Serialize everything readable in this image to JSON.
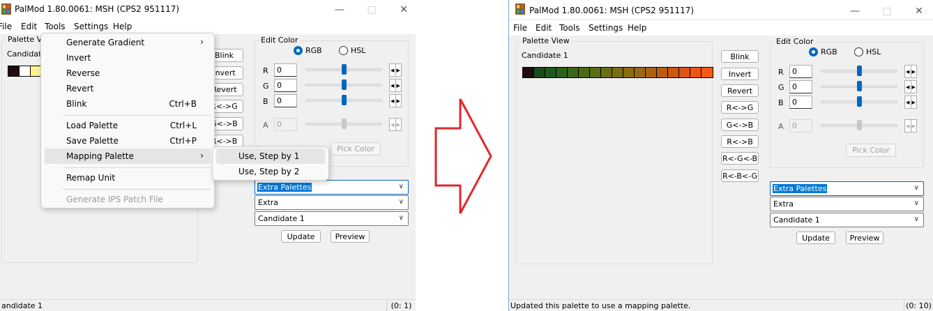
{
  "colors": {
    "accent": "#0067c0",
    "arrow_stroke": "#e3262d",
    "selection": "#0078d7"
  },
  "left_window": {
    "title": "PalMod 1.80.0061: MSH (CPS2 951117)",
    "menu": {
      "file": "File",
      "edit": "Edit",
      "tools": "Tools",
      "settings": "Settings",
      "help": "Help"
    },
    "palette_view": {
      "title": "Palette Vie",
      "candidate_label": "Candidate"
    },
    "side_buttons": {
      "blink": "Blink",
      "invert": "Invert",
      "revert": "Revert",
      "rg": "R<->G",
      "gb": "G<->B",
      "rb": "R<->B"
    },
    "edit_color": {
      "title": "Edit Color",
      "rgb": "RGB",
      "hsl": "HSL",
      "r_label": "R",
      "g_label": "G",
      "b_label": "B",
      "a_label": "A",
      "r": "0",
      "g": "0",
      "b": "0",
      "a": "0",
      "pick_color": "Pick Color"
    },
    "combos": {
      "palette_type": "Extra Palettes",
      "palette_group": "Extra",
      "palette_name": "Candidate 1"
    },
    "update": "Update",
    "preview": "Preview",
    "status_left": "andidate 1",
    "status_right": "(0: 1)",
    "swatch_colors": [
      "#200e0e",
      "#ffffff",
      "#fbf38f"
    ],
    "tools_menu": {
      "generate_gradient": "Generate Gradient",
      "invert": "Invert",
      "reverse": "Reverse",
      "revert": "Revert",
      "blink": "Blink",
      "blink_shortcut": "Ctrl+B",
      "load_palette": "Load Palette",
      "load_shortcut": "Ctrl+L",
      "save_palette": "Save Palette",
      "save_shortcut": "Ctrl+P",
      "mapping_palette": "Mapping Palette",
      "remap_unit": "Remap Unit",
      "generate_ips": "Generate IPS Patch File"
    },
    "mapping_submenu": {
      "step1": "Use, Step by 1",
      "step2": "Use, Step by 2"
    }
  },
  "right_window": {
    "title": "PalMod 1.80.0061: MSH (CPS2 951117)",
    "menu": {
      "file": "File",
      "edit": "Edit",
      "tools": "Tools",
      "settings": "Settings",
      "help": "Help"
    },
    "palette_view": {
      "title": "Palette View",
      "candidate_label": "Candidate 1"
    },
    "side_buttons": {
      "blink": "Blink",
      "invert": "Invert",
      "revert": "Revert",
      "rg": "R<->G",
      "gb": "G<->B",
      "rb": "R<->B",
      "rgb": "R<-G<-B",
      "rbg": "R<-B<-G"
    },
    "edit_color": {
      "title": "Edit Color",
      "rgb": "RGB",
      "hsl": "HSL",
      "r_label": "R",
      "g_label": "G",
      "b_label": "B",
      "a_label": "A",
      "r": "0",
      "g": "0",
      "b": "0",
      "a": "0",
      "pick_color": "Pick Color"
    },
    "combos": {
      "palette_type": "Extra Palettes",
      "palette_group": "Extra",
      "palette_name": "Candidate 1"
    },
    "update": "Update",
    "preview": "Preview",
    "status_left": "Updated this palette to use a mapping palette.",
    "status_right": "(0: 10)",
    "swatch_colors": [
      "#1e0d0d",
      "#1a4a1a",
      "#1d5a1a",
      "#2b6219",
      "#3a6818",
      "#4a6a16",
      "#5a6d15",
      "#6a6e14",
      "#7a6d13",
      "#8a6b12",
      "#9a6812",
      "#ab6311",
      "#bb5e11",
      "#cb5911",
      "#dd5512",
      "#ee5514",
      "#f85a18"
    ]
  }
}
